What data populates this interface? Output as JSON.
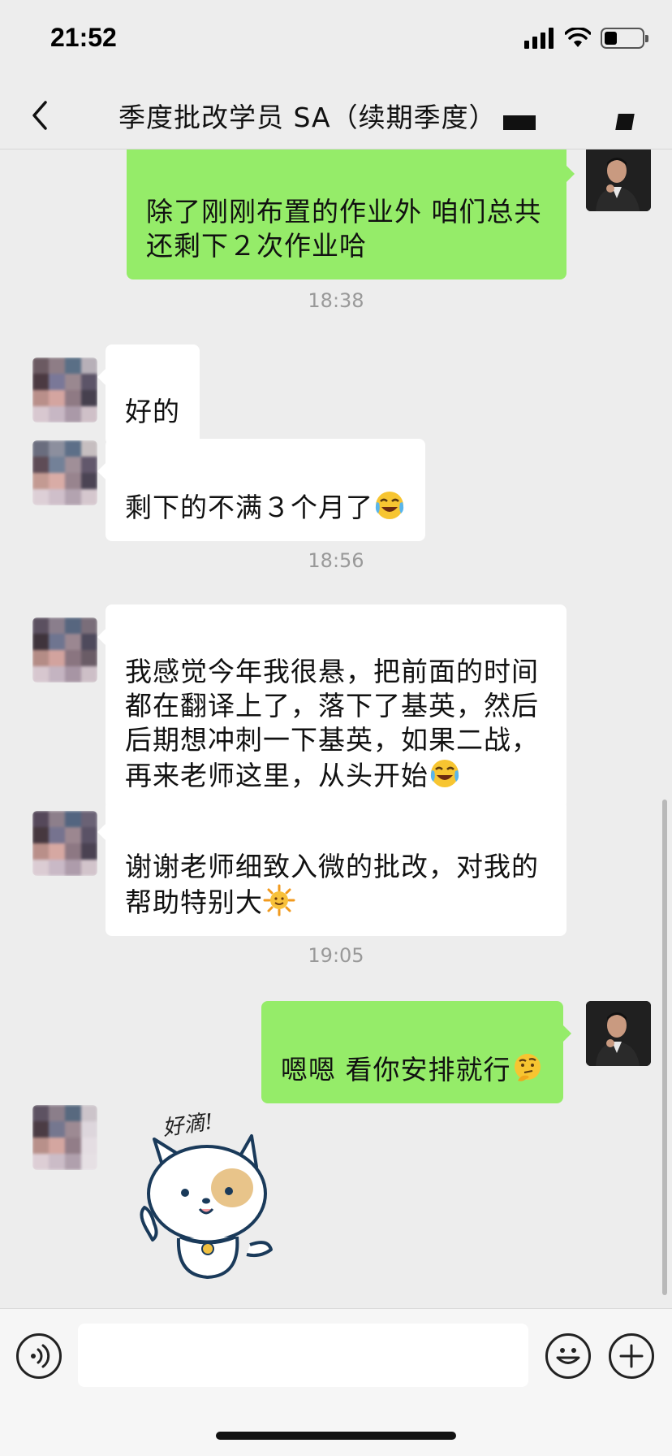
{
  "status_bar": {
    "time": "21:52",
    "battery_level": 0.3
  },
  "nav": {
    "title": "季度批改学员 SA（续期季度）",
    "back_icon": "chevron-left-icon"
  },
  "messages": {
    "m1": {
      "sender": "teacher",
      "text": "除了刚刚布置的作业外 咱们总共\n还剩下２次作业哈"
    },
    "t1": "18:38",
    "m2": {
      "sender": "student",
      "text": "好的"
    },
    "m3": {
      "sender": "student",
      "text": "剩下的不满３个月了",
      "emoji": "crying-laughing-emoji"
    },
    "t2": "18:56",
    "m4": {
      "sender": "student",
      "text": "我感觉今年我很悬，把前面的时间\n都在翻译上了，落下了基英，然后\n后期想冲刺一下基英，如果二战，\n再来老师这里，从头开始",
      "emoji": "crying-laughing-emoji"
    },
    "m5": {
      "sender": "student",
      "text": "谢谢老师细致入微的批改，对我的\n帮助特别大",
      "emoji": "sun-emoji"
    },
    "t3": "19:05",
    "m6": {
      "sender": "teacher",
      "text": "嗯嗯 看你安排就行",
      "emoji": "thinking-face-emoji"
    },
    "m7": {
      "sender": "student",
      "type": "sticker",
      "sticker_text": "好滴!"
    }
  },
  "input_bar": {
    "voice_icon": "voice-icon",
    "emoji_icon": "emoji-icon",
    "plus_icon": "plus-icon",
    "input_value": ""
  },
  "colors": {
    "background": "#ededed",
    "incoming_bubble": "#ffffff",
    "outgoing_bubble": "#95ec69",
    "timestamp": "#999999"
  }
}
